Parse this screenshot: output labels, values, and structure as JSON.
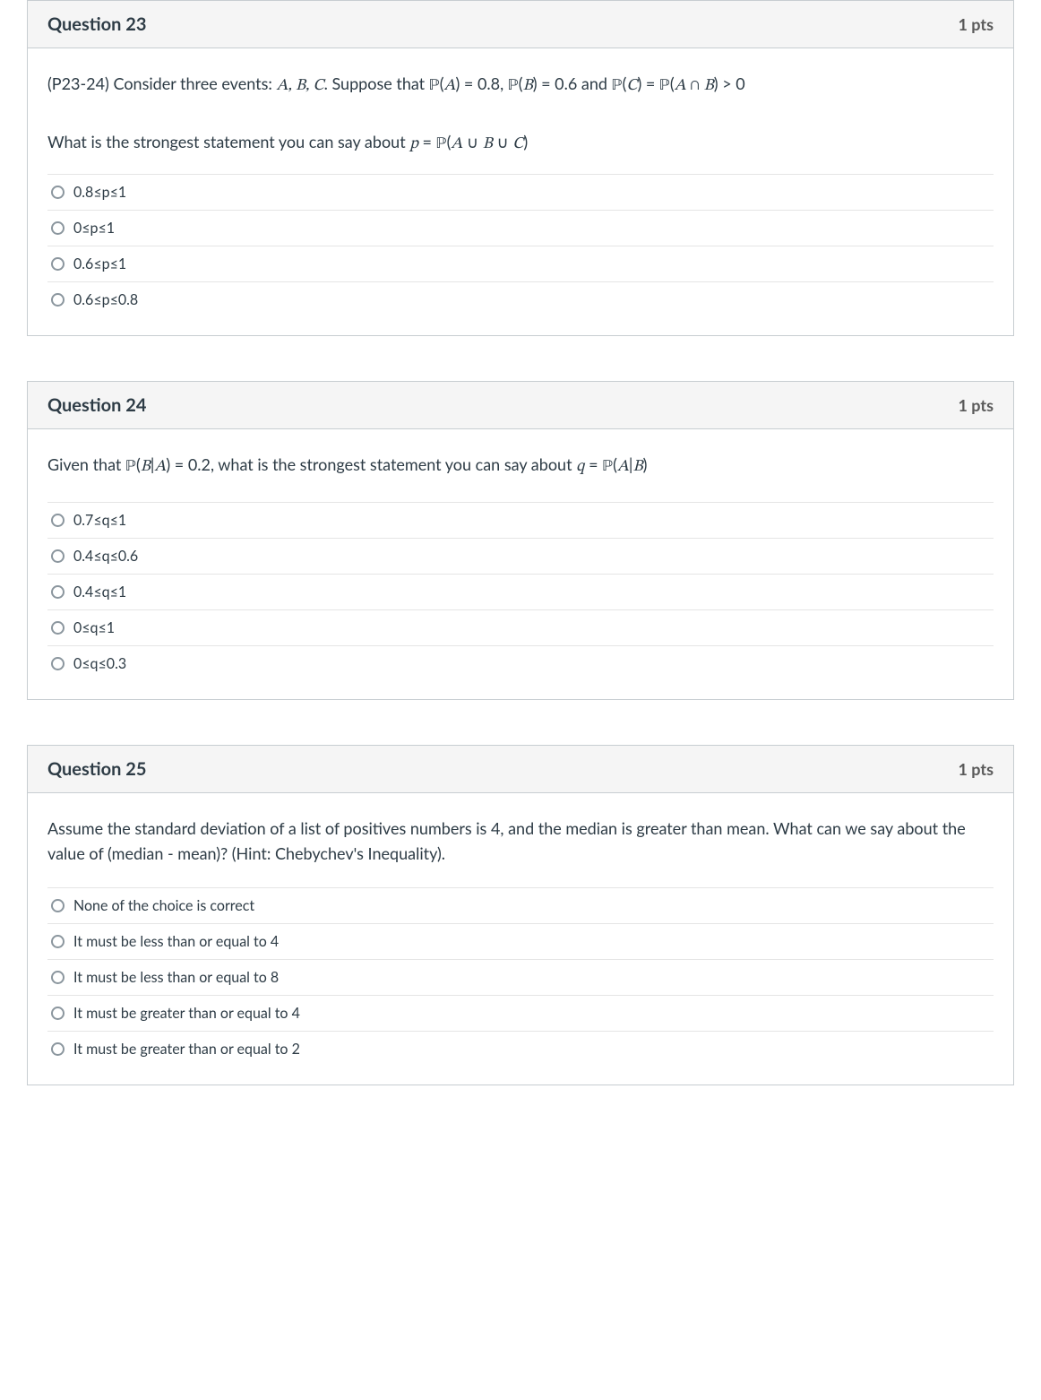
{
  "questions": [
    {
      "title": "Question 23",
      "pts": "1 pts",
      "prompt_html": "(P23-24) Consider three events: <span class='math'>A, B, C</span>. Suppose that <span class='math-bb'>ℙ</span>(<span class='math'>A</span>) = 0.8, <span class='math-bb'>ℙ</span>(<span class='math'>B</span>) = 0.6 and <span class='math-bb'>ℙ</span>(<span class='math'>C</span>) = <span class='math-bb'>ℙ</span>(<span class='math'>A</span> ∩ <span class='math'>B</span>) &gt; 0",
      "prompt_sub_html": "What is the strongest statement you can say about <span class='math'>p</span> = <span class='math-bb'>ℙ</span>(<span class='math'>A</span> ∪ <span class='math'>B</span> ∪ <span class='math'>C</span>)",
      "answers": [
        "0.8≤p≤1",
        "0≤p≤1",
        "0.6≤p≤1",
        "0.6≤p≤0.8"
      ]
    },
    {
      "title": "Question 24",
      "pts": "1 pts",
      "prompt_html": "Given that <span class='math-bb'>ℙ</span>(<span class='math'>B</span>|<span class='math'>A</span>) = 0.2, what is the strongest statement you can say about <span class='math'>q</span> = <span class='math-bb'>ℙ</span>(<span class='math'>A</span>|<span class='math'>B</span>)",
      "prompt_sub_html": "",
      "answers": [
        "0.7≤q≤1",
        "0.4≤q≤0.6",
        "0.4≤q≤1",
        "0≤q≤1",
        "0≤q≤0.3"
      ]
    },
    {
      "title": "Question 25",
      "pts": "1 pts",
      "prompt_html": "Assume the standard deviation of a list of positives numbers is 4, and the median is greater than mean. What can we say about the value of (median - mean)? (Hint: Chebychev's Inequality).",
      "prompt_sub_html": "",
      "answers": [
        "None of the choice is correct",
        "It must be less than or equal to 4",
        "It must be less than or equal to 8",
        "It must be greater than or equal to 4",
        "It must be greater than or equal to 2"
      ]
    }
  ]
}
